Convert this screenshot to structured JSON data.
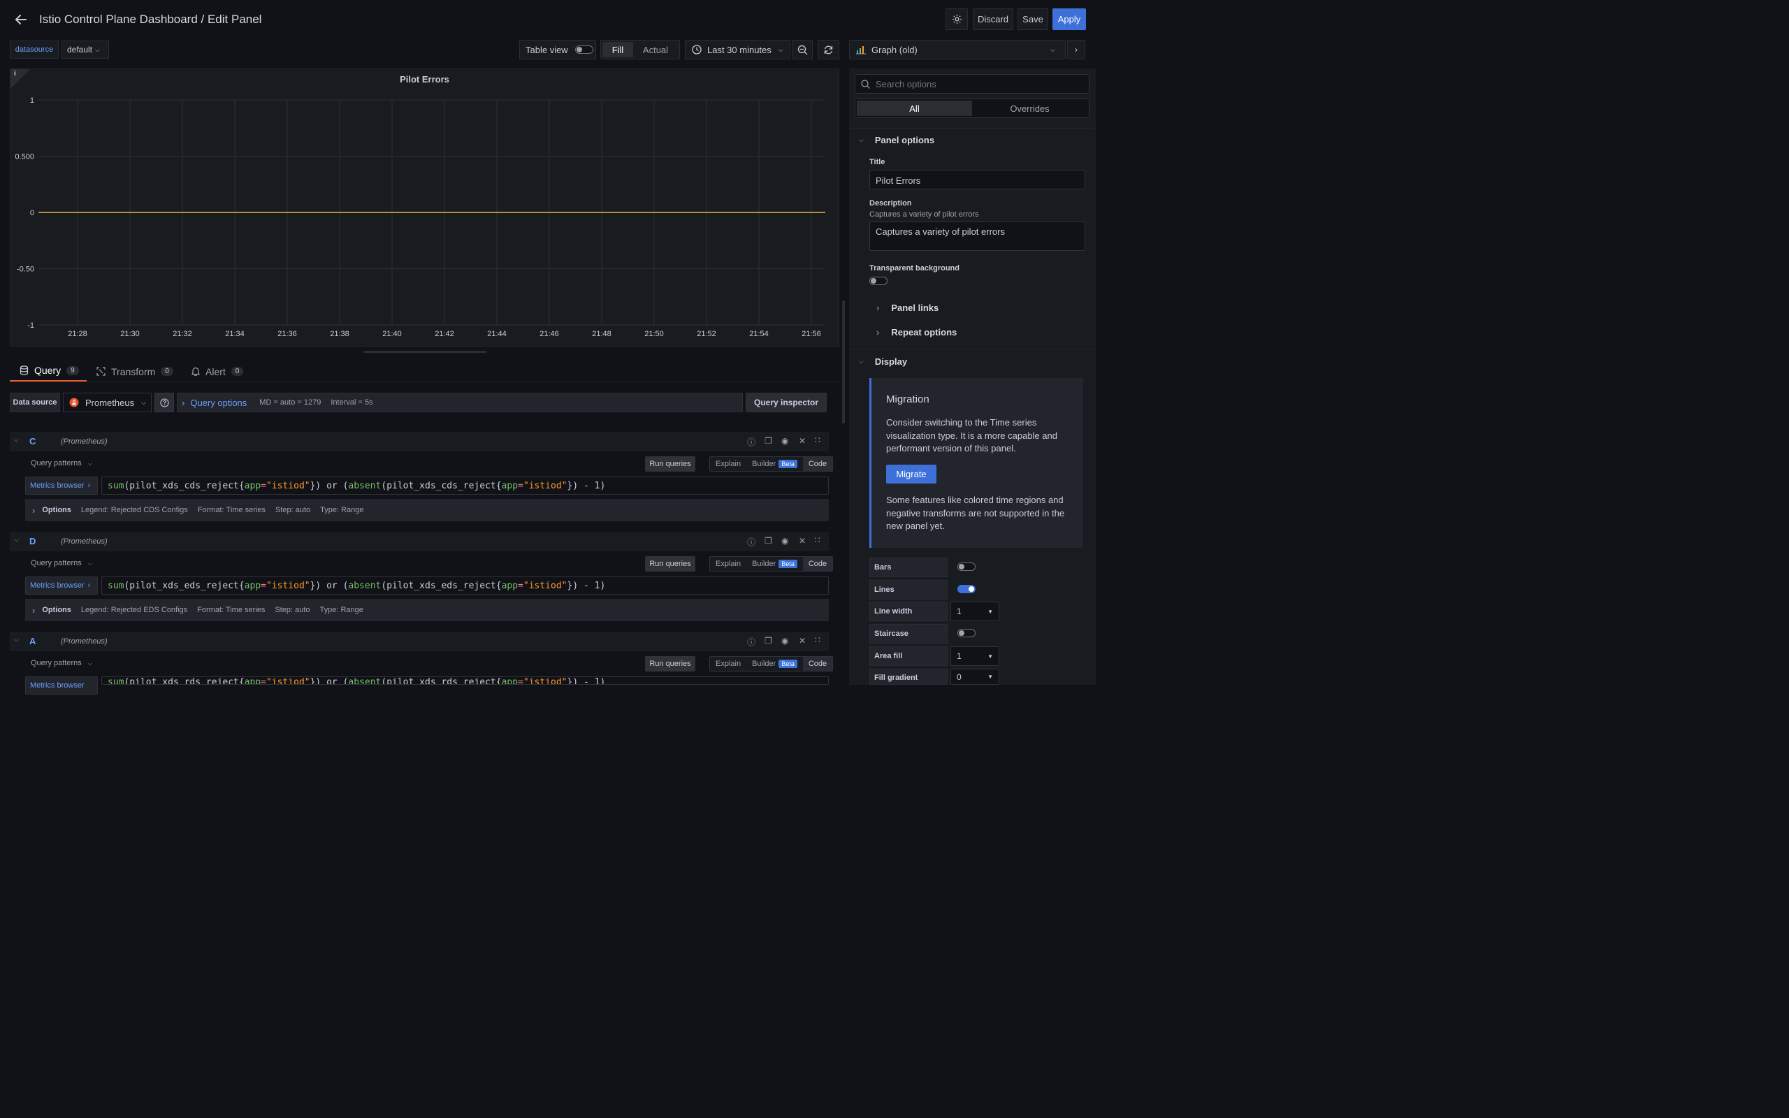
{
  "header": {
    "title": "Istio Control Plane Dashboard / Edit Panel",
    "discard_label": "Discard",
    "save_label": "Save",
    "apply_label": "Apply"
  },
  "toolbar": {
    "datasource_label": "datasource",
    "datasource_value": "default",
    "table_view_label": "Table view",
    "fill_label": "Fill",
    "actual_label": "Actual",
    "time_range": "Last 30 minutes",
    "visualization": "Graph (old)"
  },
  "panel": {
    "title": "Pilot Errors"
  },
  "chart_data": {
    "type": "line",
    "title": "Pilot Errors",
    "x": [
      "21:28",
      "21:30",
      "21:32",
      "21:34",
      "21:36",
      "21:38",
      "21:40",
      "21:42",
      "21:44",
      "21:46",
      "21:48",
      "21:50",
      "21:52",
      "21:54",
      "21:56"
    ],
    "y_ticks": [
      "1",
      "0.500",
      "0",
      "-0.50",
      "-1"
    ],
    "ylim": [
      -1,
      1
    ],
    "series": [
      {
        "color": "#eab839",
        "values": [
          0,
          0,
          0,
          0,
          0,
          0,
          0,
          0,
          0,
          0,
          0,
          0,
          0,
          0,
          0
        ]
      }
    ],
    "grid": true
  },
  "tabs": [
    {
      "label": "Query",
      "count": "9"
    },
    {
      "label": "Transform",
      "count": "0"
    },
    {
      "label": "Alert",
      "count": "0"
    }
  ],
  "query_bar": {
    "data_source_label": "Data source",
    "data_source_value": "Prometheus",
    "query_options_label": "Query options",
    "md_info": "MD = auto = 1279",
    "interval_info": "Interval = 5s",
    "inspector_label": "Query inspector"
  },
  "queries": [
    {
      "ref": "C",
      "source": "(Prometheus)",
      "patterns_label": "Query patterns",
      "run_label": "Run queries",
      "explain": "Explain",
      "builder": "Builder",
      "beta": "Beta",
      "code": "Code",
      "metrics_browser": "Metrics browser",
      "expr": {
        "fn1": "sum",
        "p1": "(pilot_xds_cds_reject{",
        "k1": "app",
        "eq1": "=",
        "v1": "\"istiod\"",
        "p2": "}) or (",
        "fn2": "absent",
        "p3": "(pilot_xds_cds_reject{",
        "k2": "app",
        "eq2": "=",
        "v2": "\"istiod\"",
        "p4": "}) - 1)"
      },
      "options_label": "Options",
      "legend": "Legend: Rejected CDS Configs",
      "format": "Format: Time series",
      "step": "Step: auto",
      "type": "Type: Range"
    },
    {
      "ref": "D",
      "source": "(Prometheus)",
      "patterns_label": "Query patterns",
      "run_label": "Run queries",
      "explain": "Explain",
      "builder": "Builder",
      "beta": "Beta",
      "code": "Code",
      "metrics_browser": "Metrics browser",
      "expr": {
        "fn1": "sum",
        "p1": "(pilot_xds_eds_reject{",
        "k1": "app",
        "eq1": "=",
        "v1": "\"istiod\"",
        "p2": "}) or (",
        "fn2": "absent",
        "p3": "(pilot_xds_eds_reject{",
        "k2": "app",
        "eq2": "=",
        "v2": "\"istiod\"",
        "p4": "}) - 1)"
      },
      "options_label": "Options",
      "legend": "Legend: Rejected EDS Configs",
      "format": "Format: Time series",
      "step": "Step: auto",
      "type": "Type: Range"
    },
    {
      "ref": "A",
      "source": "(Prometheus)",
      "patterns_label": "Query patterns",
      "run_label": "Run queries",
      "explain": "Explain",
      "builder": "Builder",
      "beta": "Beta",
      "code": "Code",
      "metrics_browser": "Metrics browser",
      "expr": {
        "fn1": "sum",
        "p1": "(pilot_xds_rds_reject{",
        "k1": "app",
        "eq1": "=",
        "v1": "\"istiod\"",
        "p2": "}) or (",
        "fn2": "absent",
        "p3": "(pilot_xds_rds_reject{",
        "k2": "app",
        "eq2": "=",
        "v2": "\"istiod\"",
        "p4": "}) - 1)"
      }
    }
  ],
  "options_pane": {
    "search_placeholder": "Search options",
    "all_label": "All",
    "overrides_label": "Overrides",
    "panel_options_label": "Panel options",
    "title_label": "Title",
    "title_value": "Pilot Errors",
    "description_label": "Description",
    "description_hint": "Captures a variety of pilot errors",
    "description_value": "Captures a variety of pilot errors",
    "transparent_label": "Transparent background",
    "panel_links_label": "Panel links",
    "repeat_options_label": "Repeat options",
    "display_label": "Display",
    "migration": {
      "title": "Migration",
      "text1": "Consider switching to the Time series visualization type. It is a more capable and performant version of this panel.",
      "button": "Migrate",
      "text2": "Some features like colored time regions and negative transforms are not supported in the new panel yet."
    },
    "display": {
      "bars_label": "Bars",
      "lines_label": "Lines",
      "line_width_label": "Line width",
      "line_width_value": "1",
      "staircase_label": "Staircase",
      "area_fill_label": "Area fill",
      "area_fill_value": "1",
      "fill_gradient_label": "Fill gradient",
      "fill_gradient_value": "0"
    }
  }
}
